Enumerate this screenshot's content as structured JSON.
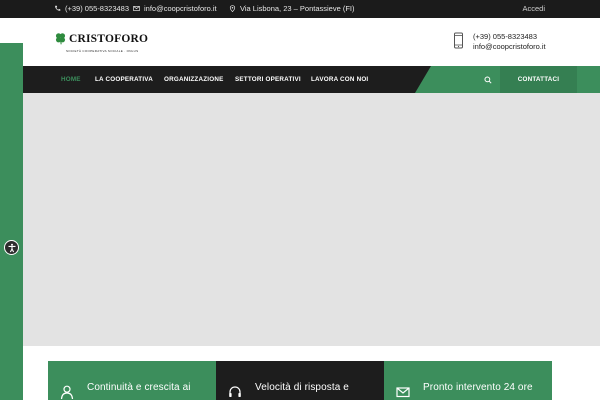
{
  "topbar": {
    "phone": "(+39) 055-8323483",
    "email": "info@coopcristoforo.it",
    "address": "Via Lisbona, 23 – Pontassieve (FI)",
    "login": "Accedi"
  },
  "logo": {
    "name": "CRISTOFORO",
    "tagline": "SOCIETÀ COOPERATIVA SOCIALE · ONLUS"
  },
  "header_contact": {
    "phone": "(+39) 055-8323483",
    "email": "info@coopcristoforo.it"
  },
  "nav": {
    "items": [
      {
        "label": "HOME",
        "active": true
      },
      {
        "label": "LA COOPERATIVA"
      },
      {
        "label": "ORGANIZZAZIONE"
      },
      {
        "label": "SETTORI OPERATIVI"
      },
      {
        "label": "LAVORA CON NOI"
      }
    ],
    "contact_button": "CONTATTACI"
  },
  "features": [
    {
      "text": "Continuità e crescita ai",
      "icon": "user-icon",
      "color": "#3c8e5c"
    },
    {
      "text": "Velocità di risposta e",
      "icon": "headset-icon",
      "color": "#1d1d1d"
    },
    {
      "text": "Pronto intervento 24 ore",
      "icon": "mail-icon",
      "color": "#3c8e5c"
    }
  ],
  "colors": {
    "brand_green": "#3c8e5c",
    "dark": "#1d1d1d",
    "hero_bg": "#e3e3e3"
  }
}
